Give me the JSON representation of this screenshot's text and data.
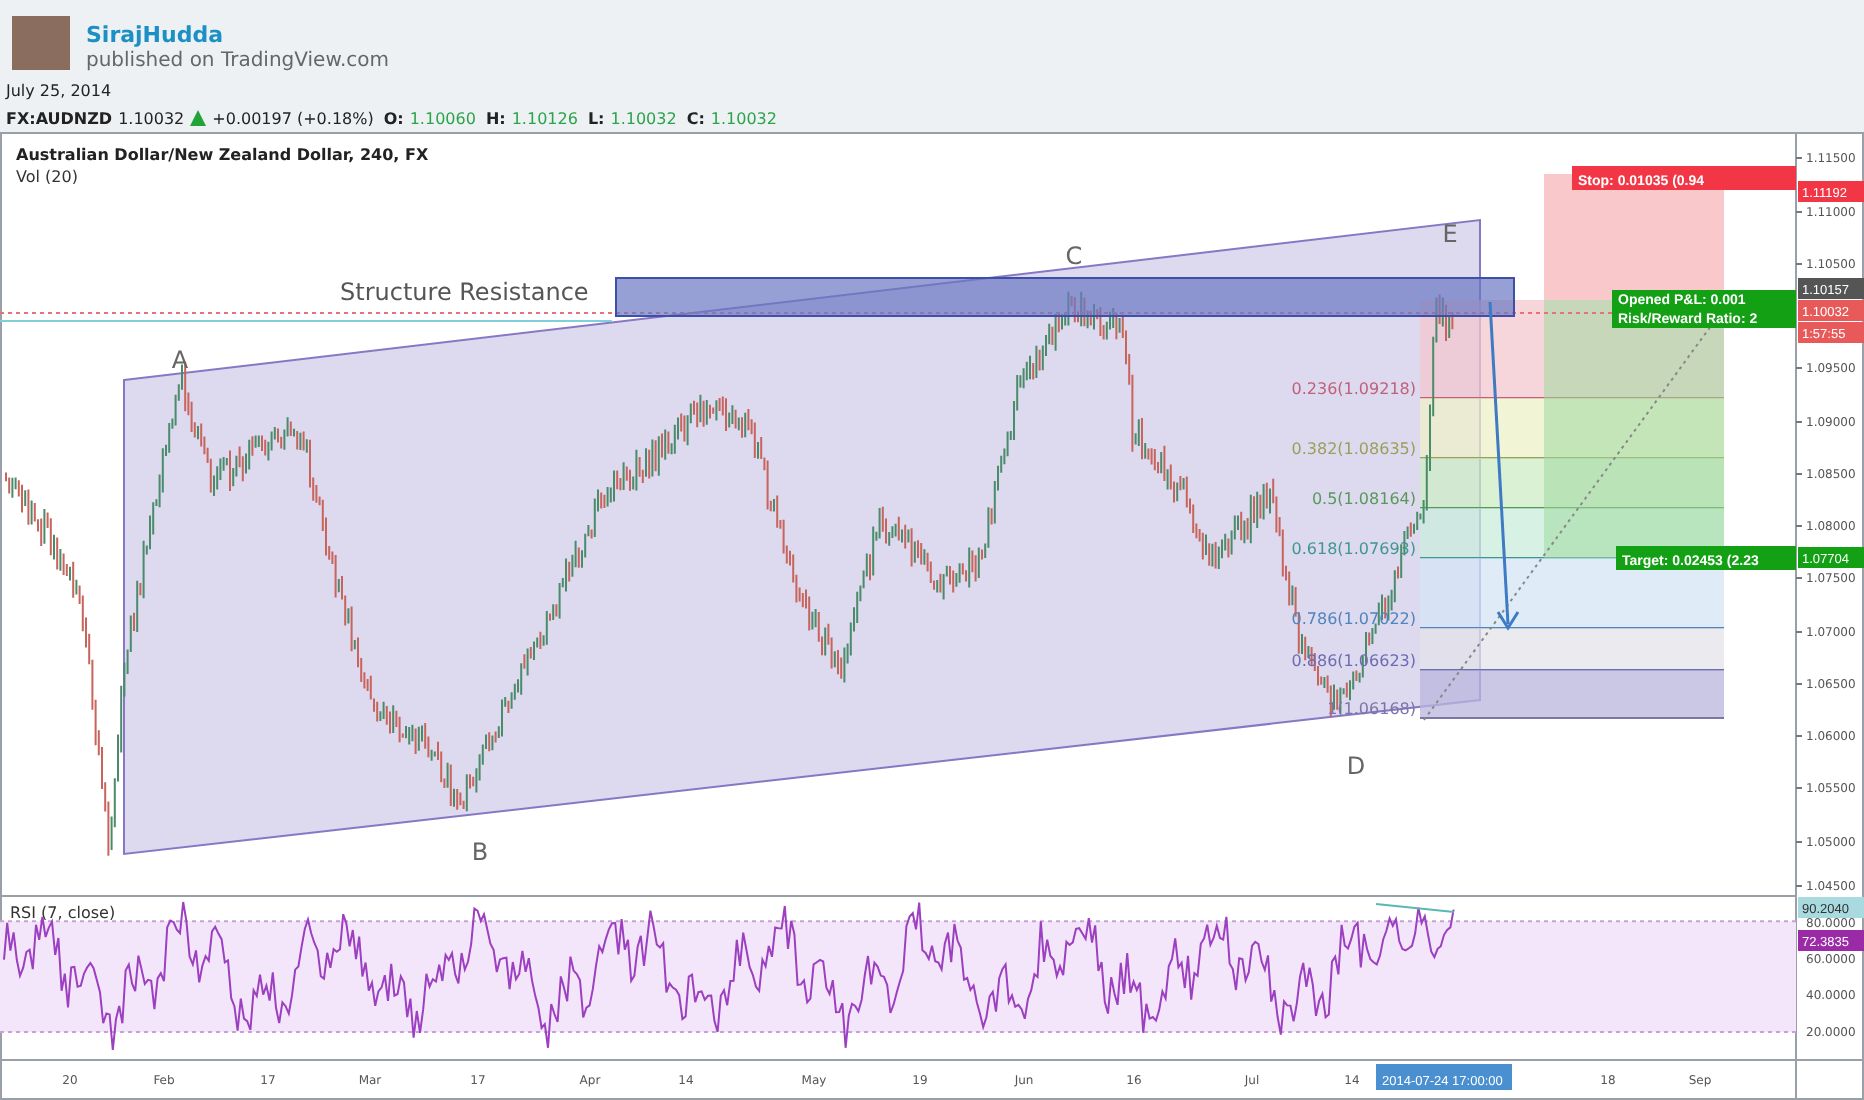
{
  "author": {
    "name": "SirajHudda",
    "published": "published on TradingView.com"
  },
  "date": "July 25, 2014",
  "quote": {
    "symbol": "FX:AUDNZD",
    "last": "1.10032",
    "change": "+0.00197 (+0.18%)",
    "ohlc": [
      {
        "label": "O:",
        "value": "1.10060"
      },
      {
        "label": "H:",
        "value": "1.10126"
      },
      {
        "label": "L:",
        "value": "1.10032"
      },
      {
        "label": "C:",
        "value": "1.10032"
      }
    ]
  },
  "chart": {
    "title": "Australian Dollar/New Zealand Dollar, 240, FX",
    "volume_label": "Vol (20)",
    "annotation": "Structure Resistance",
    "wave_labels": [
      "A",
      "B",
      "C",
      "D",
      "E"
    ],
    "fib_levels": [
      "0.236(1.09218)",
      "0.382(1.08635)",
      "0.5(1.08164)",
      "0.618(1.07693)",
      "0.786(1.07022)",
      "0.886(1.06623)",
      "1(1.06168)"
    ],
    "position": {
      "stop": "Stop: 0.01035 (0.94",
      "opened_pnl": "Opened P&L: 0.001",
      "risk_reward": "Risk/Reward Ratio: 2",
      "target": "Target: 0.02453 (2.23"
    },
    "price_axis": {
      "labels": [
        "1.11500",
        "1.11000",
        "1.10500",
        "1.09500",
        "1.09000",
        "1.08500",
        "1.08000",
        "1.07500",
        "1.07000",
        "1.06500",
        "1.06000",
        "1.05500",
        "1.05000",
        "1.04500"
      ],
      "badges": [
        {
          "text": "1.11192",
          "color": "#f23645"
        },
        {
          "text": "1.10157",
          "color": "#555555"
        },
        {
          "text": "1.10032",
          "color": "#e85a5a"
        },
        {
          "text": "1:57:55",
          "color": "#e85a5a"
        },
        {
          "text": "1.07704",
          "color": "#14a014"
        }
      ]
    }
  },
  "rsi": {
    "title": "RSI (7, close)",
    "axis_labels": [
      "80.0000",
      "60.0000",
      "40.0000",
      "20.0000"
    ],
    "badges": [
      {
        "text": "90.2040",
        "color": "#a8dadf"
      },
      {
        "text": "72.3835",
        "color": "#9a2aa6"
      }
    ]
  },
  "time_axis": {
    "labels": [
      "20",
      "Feb",
      "17",
      "Mar",
      "17",
      "Apr",
      "14",
      "May",
      "19",
      "Jun",
      "16",
      "Jul",
      "14",
      "18",
      "Sep"
    ],
    "crosshair_label": "2014-07-24 17:00:00"
  }
}
